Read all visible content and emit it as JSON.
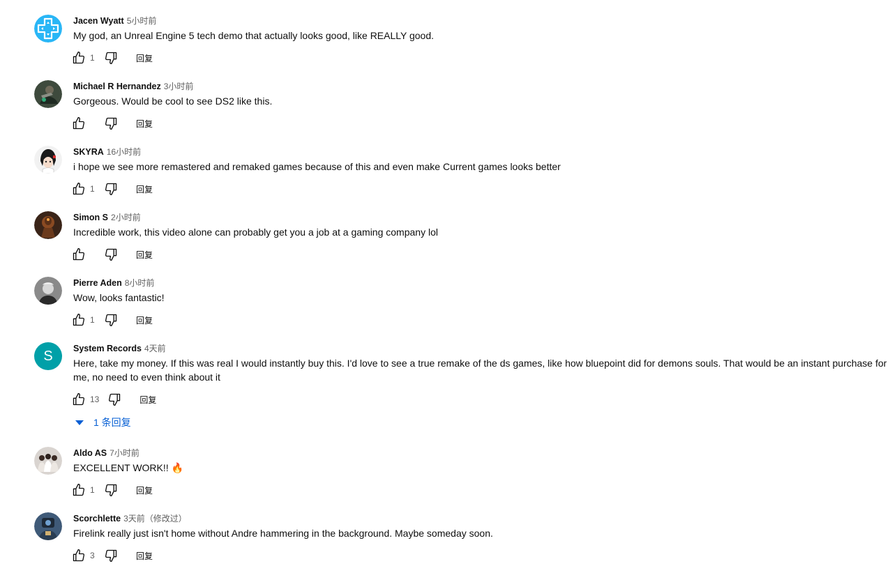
{
  "comments": [
    {
      "author": "Jacen Wyatt",
      "time": "5小时前",
      "text": "My god, an Unreal Engine 5 tech demo that actually looks good, like REALLY good.",
      "likes": "1",
      "reply_label": "回复",
      "avatar_icon": "dpad-avatar",
      "avatar_color": "#29b6f6"
    },
    {
      "author": "Michael R Hernandez",
      "time": "3小时前",
      "text": "Gorgeous. Would be cool to see DS2 like this.",
      "likes": "",
      "reply_label": "回复",
      "avatar_icon": "photo-avatar",
      "avatar_color": "#3e4a3d"
    },
    {
      "author": "SKYRA",
      "time": "16小时前",
      "text": "i hope we see more remastered and remaked games because of this and even make Current games looks better",
      "likes": "1",
      "reply_label": "回复",
      "avatar_icon": "anime-avatar",
      "avatar_color": "#f2f2f2"
    },
    {
      "author": "Simon S",
      "time": "2小时前",
      "text": "Incredible work, this video alone can probably get you a job at a gaming company lol",
      "likes": "",
      "reply_label": "回复",
      "avatar_icon": "knight-avatar",
      "avatar_color": "#3a2418"
    },
    {
      "author": "Pierre Aden",
      "time": "8小时前",
      "text": "Wow, looks fantastic!",
      "likes": "1",
      "reply_label": "回复",
      "avatar_icon": "portrait-avatar",
      "avatar_color": "#8a8a8a"
    },
    {
      "author": "System Records",
      "time": "4天前",
      "text": "Here, take my money. If this was real I would instantly buy this. I'd love to see a true remake of the ds games, like how bluepoint did for demons souls. That would be an instant purchase for me, no need to even think about it",
      "likes": "13",
      "reply_label": "回复",
      "avatar_icon": "letter-avatar",
      "avatar_letter": "S",
      "avatar_color": "#00a0a8",
      "replies_label": "1 条回复"
    },
    {
      "author": "Aldo AS",
      "time": "7小时前",
      "text": "EXCELLENT WORK!! 🔥",
      "likes": "1",
      "reply_label": "回复",
      "avatar_icon": "group-avatar",
      "avatar_color": "#d9d4d0"
    },
    {
      "author": "Scorchlette",
      "time": "3天前（修改过）",
      "text": "Firelink really just isn't home without Andre hammering in the background. Maybe someday soon.",
      "likes": "3",
      "reply_label": "回复",
      "avatar_icon": "robot-avatar",
      "avatar_color": "#3f5a78"
    }
  ]
}
